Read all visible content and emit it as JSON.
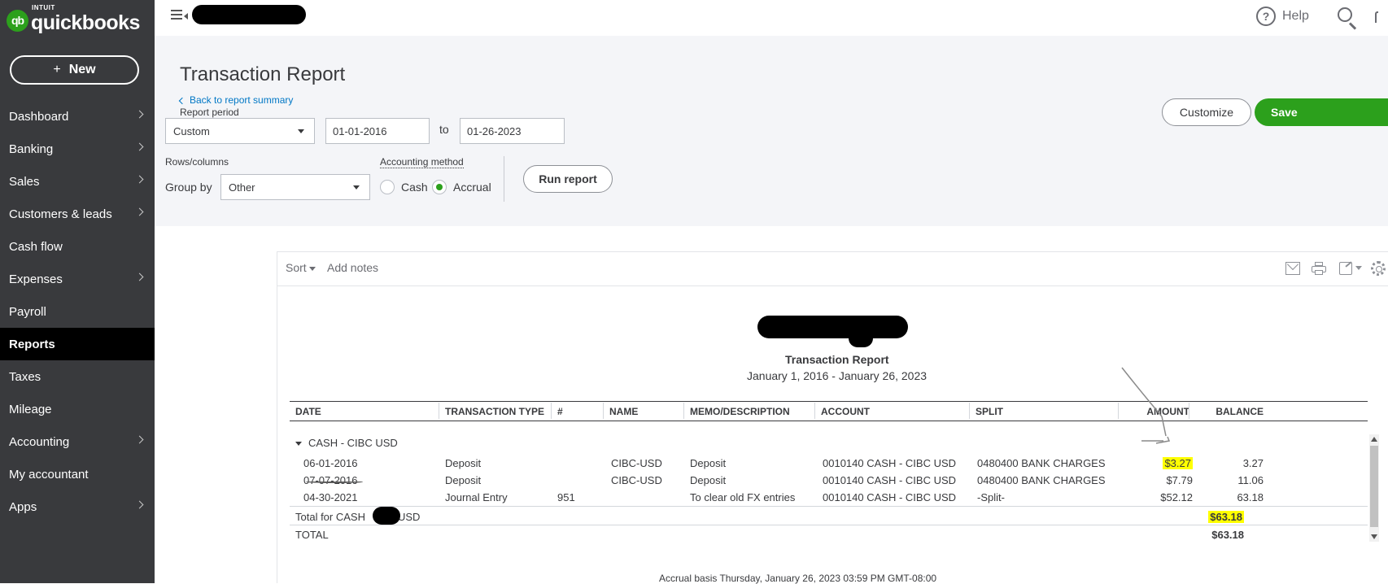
{
  "brand": {
    "badge": "qb",
    "intuit": "INTUIT",
    "name": "quickbooks"
  },
  "sidebar": {
    "new_label": "New",
    "items": [
      {
        "label": "Dashboard",
        "chevron": true
      },
      {
        "label": "Banking",
        "chevron": true
      },
      {
        "label": "Sales",
        "chevron": true
      },
      {
        "label": "Customers & leads",
        "chevron": true
      },
      {
        "label": "Cash flow",
        "chevron": false
      },
      {
        "label": "Expenses",
        "chevron": true
      },
      {
        "label": "Payroll",
        "chevron": false
      },
      {
        "label": "Reports",
        "chevron": false,
        "active": true
      },
      {
        "label": "Taxes",
        "chevron": false
      },
      {
        "label": "Mileage",
        "chevron": false
      },
      {
        "label": "Accounting",
        "chevron": true
      },
      {
        "label": "My accountant",
        "chevron": false
      },
      {
        "label": "Apps",
        "chevron": true
      }
    ]
  },
  "topbar": {
    "help_label": "Help"
  },
  "header": {
    "title": "Transaction Report",
    "back_link": "Back to report summary",
    "report_period_label": "Report period",
    "period_select": "Custom",
    "date_from": "01-01-2016",
    "to_label": "to",
    "date_to": "01-26-2023",
    "rows_columns_label": "Rows/columns",
    "group_by_label": "Group by",
    "group_by_value": "Other",
    "accounting_method_label": "Accounting method",
    "method_cash": "Cash",
    "method_accrual": "Accrual",
    "selected_method": "Accrual",
    "run_report": "Run report",
    "customize": "Customize",
    "save": "Save"
  },
  "toolbar": {
    "sort": "Sort",
    "add_notes": "Add notes"
  },
  "report": {
    "title": "Transaction Report",
    "date_range": "January 1, 2016 - January 26, 2023",
    "columns": [
      "DATE",
      "TRANSACTION TYPE",
      "#",
      "NAME",
      "MEMO/DESCRIPTION",
      "ACCOUNT",
      "SPLIT",
      "AMOUNT",
      "BALANCE"
    ],
    "group_name": "CASH - CIBC USD",
    "rows": [
      {
        "date": "06-01-2016",
        "type": "Deposit",
        "num": "",
        "name": "CIBC-USD",
        "memo": "Deposit",
        "account": "0010140 CASH - CIBC USD",
        "split": "0480400 BANK CHARGES",
        "amount": "$3.27",
        "balance": "3.27"
      },
      {
        "date": "07-07-2016",
        "type": "Deposit",
        "num": "",
        "name": "CIBC-USD",
        "memo": "Deposit",
        "account": "0010140 CASH - CIBC USD",
        "split": "0480400 BANK CHARGES",
        "amount": "$7.79",
        "balance": "11.06"
      },
      {
        "date": "04-30-2021",
        "type": "Journal Entry",
        "num": "951",
        "name": "",
        "memo": "To clear old FX entries",
        "account": "0010140 CASH - CIBC USD",
        "split": "-Split-",
        "amount": "$52.12",
        "balance": "63.18"
      }
    ],
    "total_group_label_left": "Total for CASH",
    "total_group_label_right": "USD",
    "total_group_amount": "$63.18",
    "total_label": "TOTAL",
    "total_amount": "$63.18",
    "footer": "Accrual basis  Thursday, January 26, 2023   03:59 PM GMT-08:00"
  },
  "colors": {
    "sidebar_bg": "#393a3d",
    "brand_green": "#2ca01c",
    "link_blue": "#0077c5",
    "highlight": "#ffff00"
  }
}
